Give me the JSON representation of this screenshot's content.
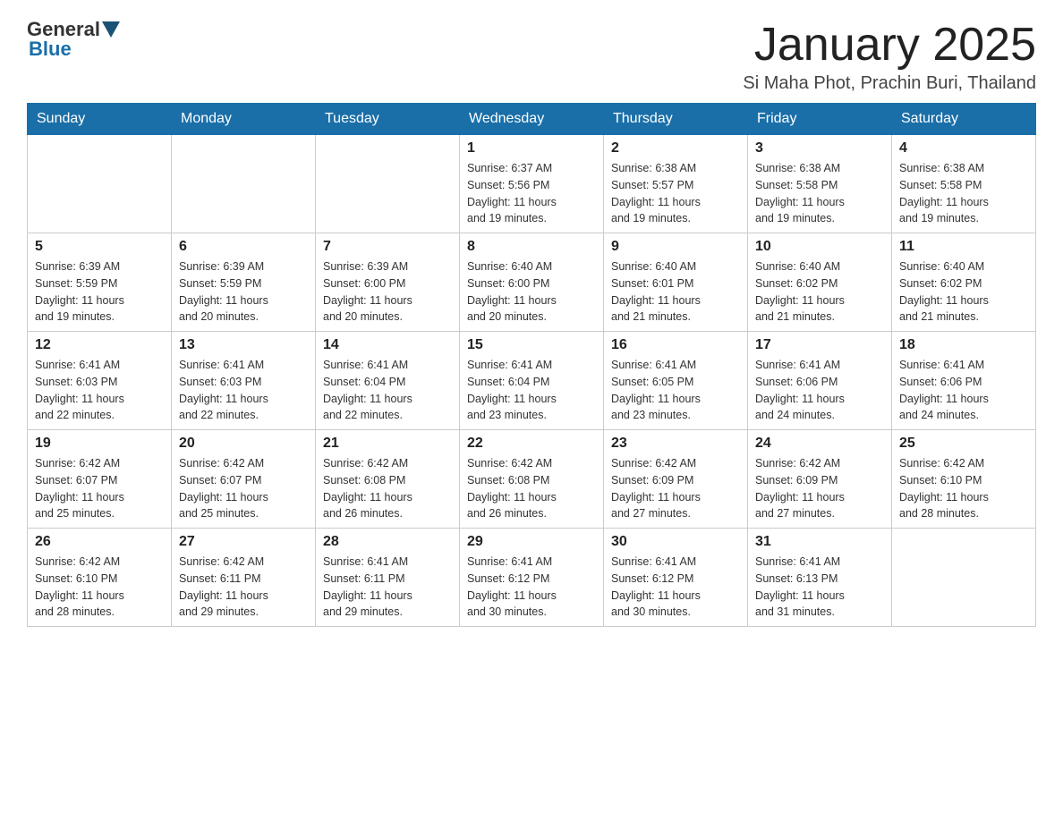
{
  "header": {
    "logo_general": "General",
    "logo_blue": "Blue",
    "title": "January 2025",
    "location": "Si Maha Phot, Prachin Buri, Thailand"
  },
  "calendar": {
    "days_of_week": [
      "Sunday",
      "Monday",
      "Tuesday",
      "Wednesday",
      "Thursday",
      "Friday",
      "Saturday"
    ],
    "weeks": [
      [
        {
          "day": "",
          "info": ""
        },
        {
          "day": "",
          "info": ""
        },
        {
          "day": "",
          "info": ""
        },
        {
          "day": "1",
          "info": "Sunrise: 6:37 AM\nSunset: 5:56 PM\nDaylight: 11 hours\nand 19 minutes."
        },
        {
          "day": "2",
          "info": "Sunrise: 6:38 AM\nSunset: 5:57 PM\nDaylight: 11 hours\nand 19 minutes."
        },
        {
          "day": "3",
          "info": "Sunrise: 6:38 AM\nSunset: 5:58 PM\nDaylight: 11 hours\nand 19 minutes."
        },
        {
          "day": "4",
          "info": "Sunrise: 6:38 AM\nSunset: 5:58 PM\nDaylight: 11 hours\nand 19 minutes."
        }
      ],
      [
        {
          "day": "5",
          "info": "Sunrise: 6:39 AM\nSunset: 5:59 PM\nDaylight: 11 hours\nand 19 minutes."
        },
        {
          "day": "6",
          "info": "Sunrise: 6:39 AM\nSunset: 5:59 PM\nDaylight: 11 hours\nand 20 minutes."
        },
        {
          "day": "7",
          "info": "Sunrise: 6:39 AM\nSunset: 6:00 PM\nDaylight: 11 hours\nand 20 minutes."
        },
        {
          "day": "8",
          "info": "Sunrise: 6:40 AM\nSunset: 6:00 PM\nDaylight: 11 hours\nand 20 minutes."
        },
        {
          "day": "9",
          "info": "Sunrise: 6:40 AM\nSunset: 6:01 PM\nDaylight: 11 hours\nand 21 minutes."
        },
        {
          "day": "10",
          "info": "Sunrise: 6:40 AM\nSunset: 6:02 PM\nDaylight: 11 hours\nand 21 minutes."
        },
        {
          "day": "11",
          "info": "Sunrise: 6:40 AM\nSunset: 6:02 PM\nDaylight: 11 hours\nand 21 minutes."
        }
      ],
      [
        {
          "day": "12",
          "info": "Sunrise: 6:41 AM\nSunset: 6:03 PM\nDaylight: 11 hours\nand 22 minutes."
        },
        {
          "day": "13",
          "info": "Sunrise: 6:41 AM\nSunset: 6:03 PM\nDaylight: 11 hours\nand 22 minutes."
        },
        {
          "day": "14",
          "info": "Sunrise: 6:41 AM\nSunset: 6:04 PM\nDaylight: 11 hours\nand 22 minutes."
        },
        {
          "day": "15",
          "info": "Sunrise: 6:41 AM\nSunset: 6:04 PM\nDaylight: 11 hours\nand 23 minutes."
        },
        {
          "day": "16",
          "info": "Sunrise: 6:41 AM\nSunset: 6:05 PM\nDaylight: 11 hours\nand 23 minutes."
        },
        {
          "day": "17",
          "info": "Sunrise: 6:41 AM\nSunset: 6:06 PM\nDaylight: 11 hours\nand 24 minutes."
        },
        {
          "day": "18",
          "info": "Sunrise: 6:41 AM\nSunset: 6:06 PM\nDaylight: 11 hours\nand 24 minutes."
        }
      ],
      [
        {
          "day": "19",
          "info": "Sunrise: 6:42 AM\nSunset: 6:07 PM\nDaylight: 11 hours\nand 25 minutes."
        },
        {
          "day": "20",
          "info": "Sunrise: 6:42 AM\nSunset: 6:07 PM\nDaylight: 11 hours\nand 25 minutes."
        },
        {
          "day": "21",
          "info": "Sunrise: 6:42 AM\nSunset: 6:08 PM\nDaylight: 11 hours\nand 26 minutes."
        },
        {
          "day": "22",
          "info": "Sunrise: 6:42 AM\nSunset: 6:08 PM\nDaylight: 11 hours\nand 26 minutes."
        },
        {
          "day": "23",
          "info": "Sunrise: 6:42 AM\nSunset: 6:09 PM\nDaylight: 11 hours\nand 27 minutes."
        },
        {
          "day": "24",
          "info": "Sunrise: 6:42 AM\nSunset: 6:09 PM\nDaylight: 11 hours\nand 27 minutes."
        },
        {
          "day": "25",
          "info": "Sunrise: 6:42 AM\nSunset: 6:10 PM\nDaylight: 11 hours\nand 28 minutes."
        }
      ],
      [
        {
          "day": "26",
          "info": "Sunrise: 6:42 AM\nSunset: 6:10 PM\nDaylight: 11 hours\nand 28 minutes."
        },
        {
          "day": "27",
          "info": "Sunrise: 6:42 AM\nSunset: 6:11 PM\nDaylight: 11 hours\nand 29 minutes."
        },
        {
          "day": "28",
          "info": "Sunrise: 6:41 AM\nSunset: 6:11 PM\nDaylight: 11 hours\nand 29 minutes."
        },
        {
          "day": "29",
          "info": "Sunrise: 6:41 AM\nSunset: 6:12 PM\nDaylight: 11 hours\nand 30 minutes."
        },
        {
          "day": "30",
          "info": "Sunrise: 6:41 AM\nSunset: 6:12 PM\nDaylight: 11 hours\nand 30 minutes."
        },
        {
          "day": "31",
          "info": "Sunrise: 6:41 AM\nSunset: 6:13 PM\nDaylight: 11 hours\nand 31 minutes."
        },
        {
          "day": "",
          "info": ""
        }
      ]
    ]
  }
}
